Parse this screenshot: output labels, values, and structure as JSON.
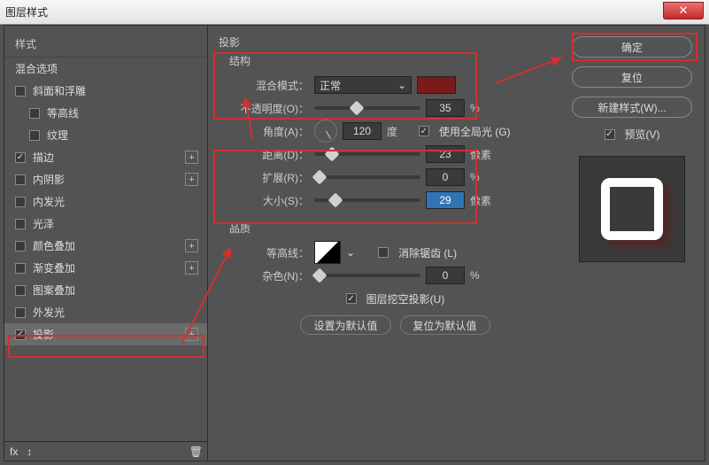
{
  "window": {
    "title": "图层样式"
  },
  "sidebar": {
    "header": "样式",
    "blend": "混合选项",
    "items": [
      {
        "label": "斜面和浮雕",
        "checked": false,
        "plus": false
      },
      {
        "label": "等高线",
        "checked": false,
        "sub": true
      },
      {
        "label": "纹理",
        "checked": false,
        "sub": true
      },
      {
        "label": "描边",
        "checked": true,
        "plus": true
      },
      {
        "label": "内阴影",
        "checked": false,
        "plus": true
      },
      {
        "label": "内发光",
        "checked": false
      },
      {
        "label": "光泽",
        "checked": false
      },
      {
        "label": "颜色叠加",
        "checked": false,
        "plus": true
      },
      {
        "label": "渐变叠加",
        "checked": false,
        "plus": true
      },
      {
        "label": "图案叠加",
        "checked": false
      },
      {
        "label": "外发光",
        "checked": false
      },
      {
        "label": "投影",
        "checked": true,
        "plus": true,
        "selected": true
      }
    ]
  },
  "main": {
    "section": "投影",
    "groups": {
      "structure": "结构",
      "quality": "品质"
    },
    "labels": {
      "blend_mode": "混合模式：",
      "opacity": "不透明度(O)：",
      "angle": "角度(A)：",
      "angle_unit": "度",
      "global_light": "使用全局光 (G)",
      "distance": "距离(D)：",
      "spread": "扩展(R)：",
      "size": "大小(S)：",
      "contour": "等高线：",
      "antialias": "消除锯齿 (L)",
      "noise": "杂色(N)：",
      "knockout": "图层挖空投影(U)",
      "set_default": "设置为默认值",
      "reset_default": "复位为默认值",
      "px": "像素",
      "pct": "%"
    },
    "values": {
      "blend_mode": "正常",
      "opacity": "35",
      "angle": "120",
      "distance": "23",
      "spread": "0",
      "size": "29",
      "noise": "0",
      "global_light_checked": true,
      "antialias_checked": false,
      "knockout_checked": true
    }
  },
  "right": {
    "ok": "确定",
    "reset": "复位",
    "new_style": "新建样式(W)...",
    "preview": "预览(V)",
    "preview_checked": true
  },
  "status": {
    "fx": "fx",
    "arrows": "↕"
  },
  "colors": {
    "swatch": "#7a1a1a",
    "highlight": "#d32f2f"
  }
}
